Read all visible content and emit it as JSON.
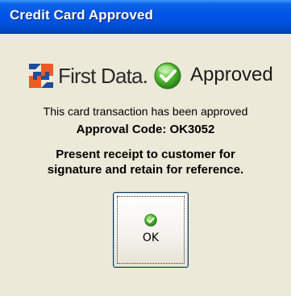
{
  "window": {
    "title": "Credit Card Approved"
  },
  "brand": {
    "name": "First Data.",
    "logo_icon": "first-data-logo-icon",
    "logo_colors": [
      "#1f4e9a",
      "#ef5a24"
    ]
  },
  "status": {
    "icon": "check-circle-icon",
    "text": "Approved",
    "color": "#3a9a2a"
  },
  "message": {
    "transaction": "This card transaction has been approved",
    "approval_code": "Approval Code: OK3052",
    "notice_line1": "Present receipt to customer for",
    "notice_line2": "signature and retain for reference."
  },
  "ok_button": {
    "label": "OK",
    "icon": "check-circle-icon"
  }
}
